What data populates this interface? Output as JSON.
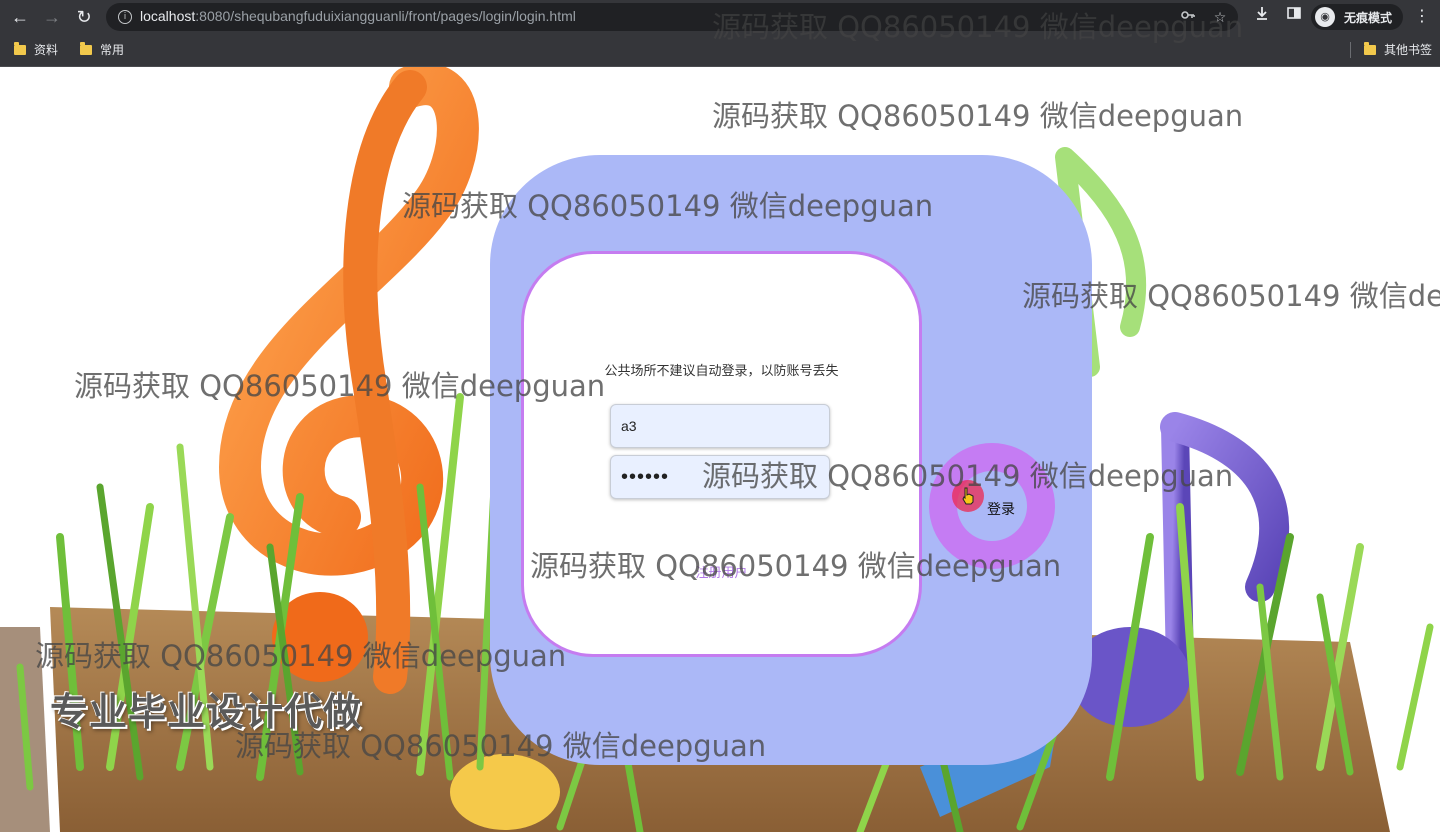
{
  "browser": {
    "url_host": "localhost",
    "url_path": ":8080/shequbangfuduixiangguanli/front/pages/login/login.html",
    "incognito_label": "无痕模式",
    "bookmarks": [
      "资料",
      "常用"
    ],
    "other_bookmarks": "其他书签"
  },
  "login": {
    "notice": "公共场所不建议自动登录，以防账号丢失",
    "username_value": "a3",
    "password_value": "••••••",
    "register_link": "注册用户",
    "login_button": "登录"
  },
  "banner": "专业毕业设计代做",
  "watermark": "源码获取 QQ86050149 微信deepguan",
  "colors": {
    "outer_panel": "#abb8f7",
    "card_border": "#c57cf0",
    "login_ring": "#c57cf3",
    "field_bg": "#e9f0ff"
  },
  "icons": [
    "back-icon",
    "forward-icon",
    "reload-icon",
    "info-icon",
    "key-icon",
    "star-icon",
    "download-icon",
    "sidebar-icon",
    "incognito-icon",
    "menu-icon",
    "folder-icon"
  ]
}
